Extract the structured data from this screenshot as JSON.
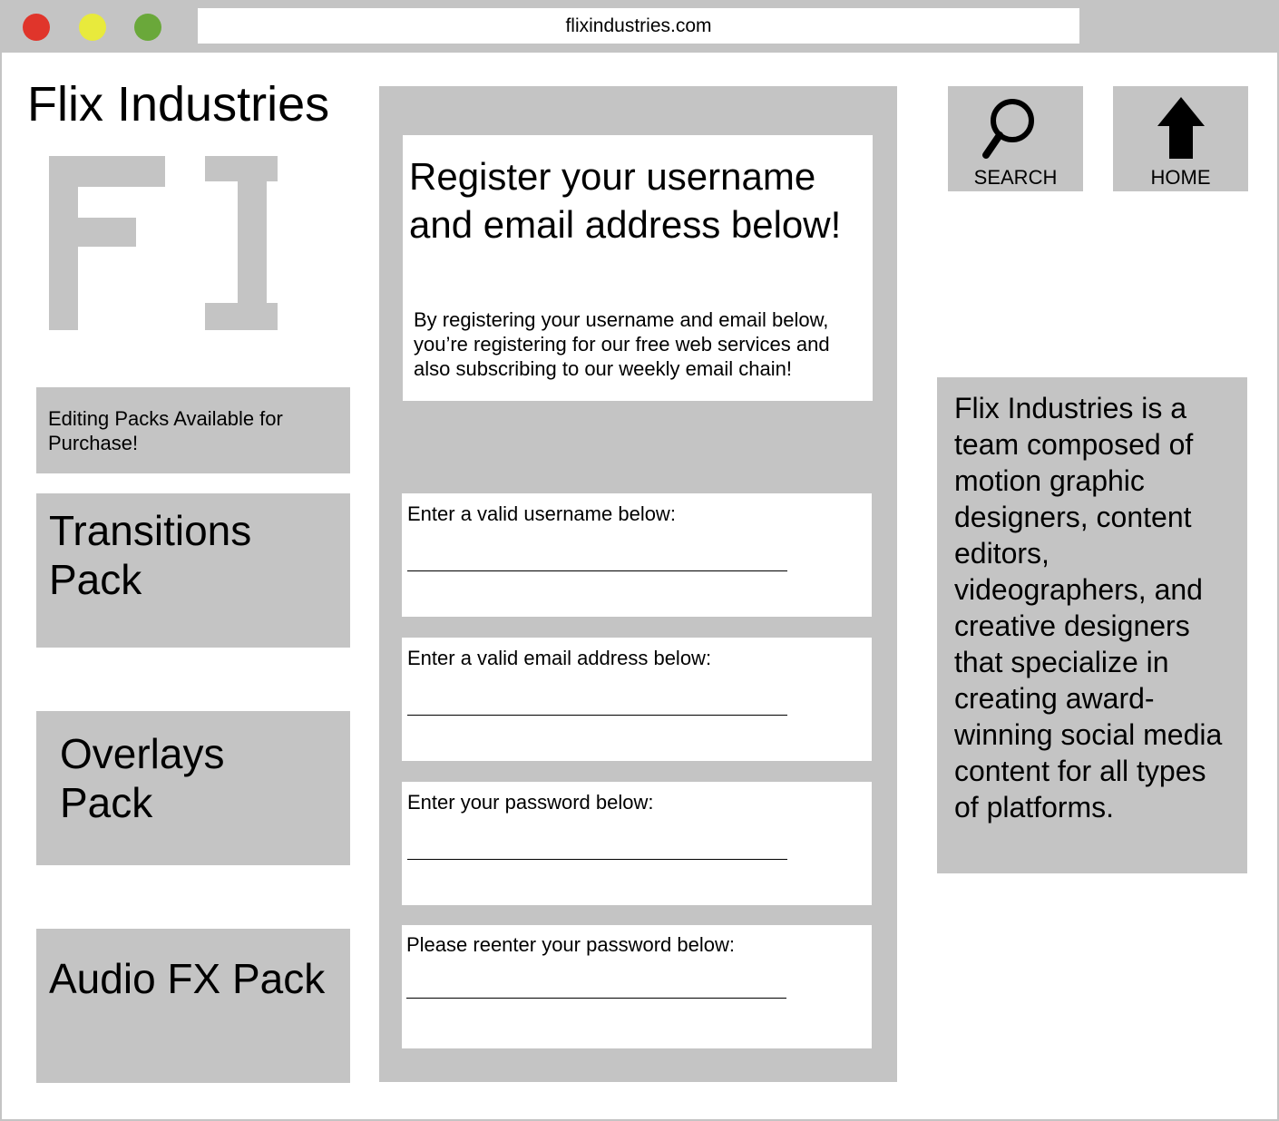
{
  "browser": {
    "url": "flixindustries.com",
    "window_controls": [
      "close",
      "minimize",
      "maximize"
    ]
  },
  "site": {
    "title": "Flix Industries",
    "logo_text": "FI"
  },
  "sidebar": {
    "packs_label": "Editing Packs Available for Purchase!",
    "packs": [
      {
        "label": "Transitions Pack"
      },
      {
        "label": "Overlays Pack"
      },
      {
        "label": "Audio FX Pack"
      }
    ]
  },
  "register": {
    "heading": "Register your username and email address below!",
    "description": "By registering your username and email below, you’re registering for our free web services and also subscribing to our weekly email chain!",
    "fields": [
      {
        "label": "Enter a valid username below:",
        "value": ""
      },
      {
        "label": "Enter a valid email address below:",
        "value": ""
      },
      {
        "label": "Enter your password below:",
        "value": ""
      },
      {
        "label": "Please reenter your password below:",
        "value": ""
      }
    ]
  },
  "nav": {
    "search_label": "SEARCH",
    "home_label": "HOME",
    "search_icon": "magnifier-icon",
    "home_icon": "up-arrow-icon"
  },
  "about": {
    "text": "Flix Industries is a team composed of motion graphic designers, content editors, videographers, and creative designers that specialize in creating award-winning social media content for all types of platforms."
  },
  "colors": {
    "panel_gray": "#c4c4c4",
    "close_red": "#e0352b",
    "minimize_yellow": "#e8ea3c",
    "maximize_green": "#6aa83a"
  }
}
